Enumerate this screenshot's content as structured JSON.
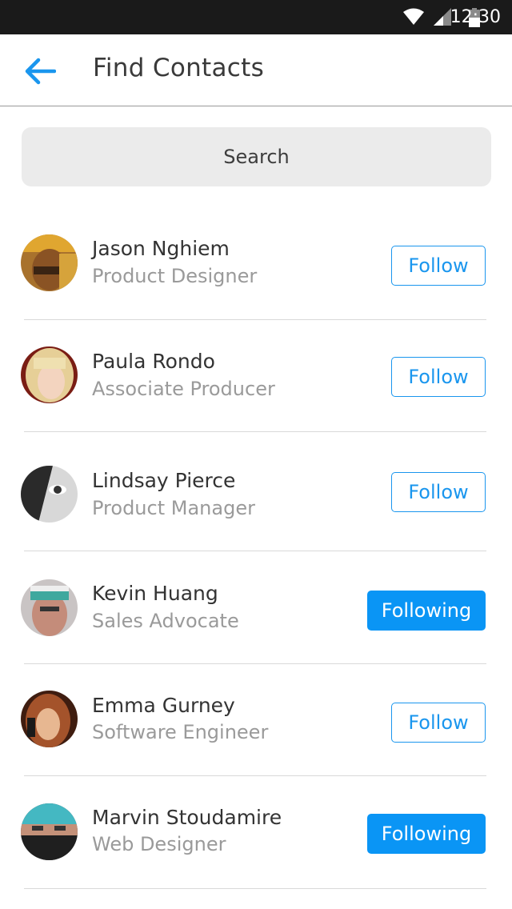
{
  "status_bar": {
    "time": "12:30",
    "icons": [
      "wifi-icon",
      "signal-icon",
      "battery-icon"
    ]
  },
  "app_bar": {
    "back_icon": "arrow-left-icon",
    "title": "Find Contacts"
  },
  "search": {
    "label": "Search"
  },
  "colors": {
    "accent": "#0a95f5",
    "status_bar": "#1a1a1a",
    "search_bg": "#ebebeb",
    "secondary_text": "#9a9a9a"
  },
  "contacts": [
    {
      "name": "Jason Nghiem",
      "role": "Product Designer",
      "button": "Follow",
      "following": false
    },
    {
      "name": "Paula Rondo",
      "role": "Associate Producer",
      "button": "Follow",
      "following": false
    },
    {
      "name": "Lindsay Pierce",
      "role": "Product Manager",
      "button": "Follow",
      "following": false
    },
    {
      "name": "Kevin Huang",
      "role": "Sales Advocate",
      "button": "Following",
      "following": true
    },
    {
      "name": "Emma Gurney",
      "role": "Software Engineer",
      "button": "Follow",
      "following": false
    },
    {
      "name": "Marvin Stoudamire",
      "role": "Web Designer",
      "button": "Following",
      "following": true
    }
  ]
}
